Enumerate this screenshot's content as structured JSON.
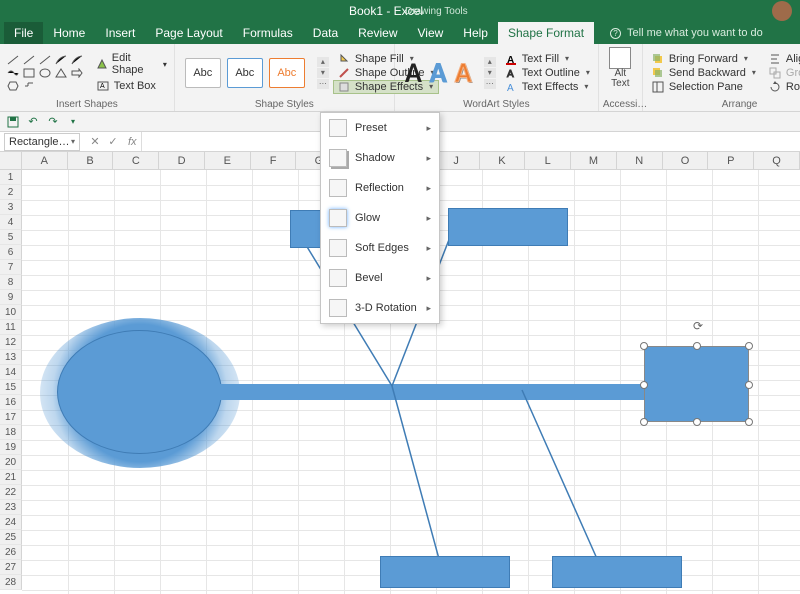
{
  "title": "Book1 - Excel",
  "contextTab": "Drawing Tools",
  "tabs": {
    "file": "File",
    "home": "Home",
    "insert": "Insert",
    "pageLayout": "Page Layout",
    "formulas": "Formulas",
    "data": "Data",
    "review": "Review",
    "view": "View",
    "help": "Help",
    "shapeFormat": "Shape Format"
  },
  "tellMe": "Tell me what you want to do",
  "ribbon": {
    "insertShapes": {
      "label": "Insert Shapes",
      "editShape": "Edit Shape",
      "textBox": "Text Box"
    },
    "shapeStyles": {
      "label": "Shape Styles",
      "abc": "Abc",
      "shapeFill": "Shape Fill",
      "shapeOutline": "Shape Outline",
      "shapeEffects": "Shape Effects"
    },
    "wordArt": {
      "label": "WordArt Styles",
      "textFill": "Text Fill",
      "textOutline": "Text Outline",
      "textEffects": "Text Effects",
      "A": "A"
    },
    "altText": {
      "label": "Accessi…",
      "btn": "Alt\nText"
    },
    "arrange": {
      "label": "Arrange",
      "bringForward": "Bring Forward",
      "sendBackward": "Send Backward",
      "selectionPane": "Selection Pane",
      "align": "Align",
      "group": "Group",
      "rotate": "Rotate"
    }
  },
  "effectsMenu": {
    "preset": "Preset",
    "shadow": "Shadow",
    "reflection": "Reflection",
    "glow": "Glow",
    "softEdges": "Soft Edges",
    "bevel": "Bevel",
    "rotation3d": "3-D Rotation"
  },
  "nameBox": "Rectangle…",
  "columns": [
    "A",
    "B",
    "C",
    "D",
    "E",
    "F",
    "G",
    "H",
    "I",
    "J",
    "K",
    "L",
    "M",
    "N",
    "O",
    "P",
    "Q"
  ],
  "rows": [
    "1",
    "2",
    "3",
    "4",
    "5",
    "6",
    "7",
    "8",
    "9",
    "10",
    "11",
    "12",
    "13",
    "14",
    "15",
    "16",
    "17",
    "18",
    "19",
    "20",
    "21",
    "22",
    "23",
    "24",
    "25",
    "26",
    "27",
    "28"
  ]
}
